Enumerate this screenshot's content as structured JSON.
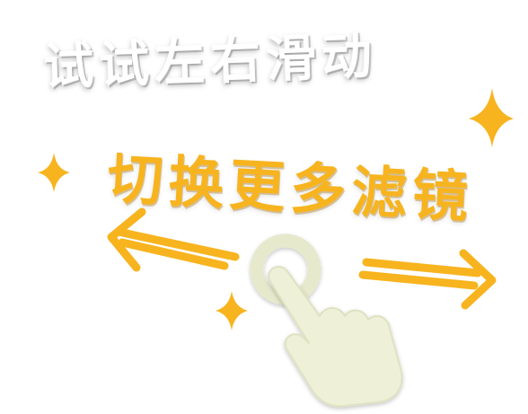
{
  "hint": {
    "line1": "试试左右滑动",
    "line2": "切换更多滤镜"
  },
  "icons": {
    "left_arrow": "arrow-left-icon",
    "right_arrow": "arrow-right-icon",
    "hand": "swipe-hand-icon",
    "sparkle": "sparkle-icon"
  },
  "colors": {
    "accent": "#f7b41f",
    "hand_fill": "#eef0d8",
    "touch_ring": "#e6e9cc",
    "text_primary": "#ffffff"
  }
}
